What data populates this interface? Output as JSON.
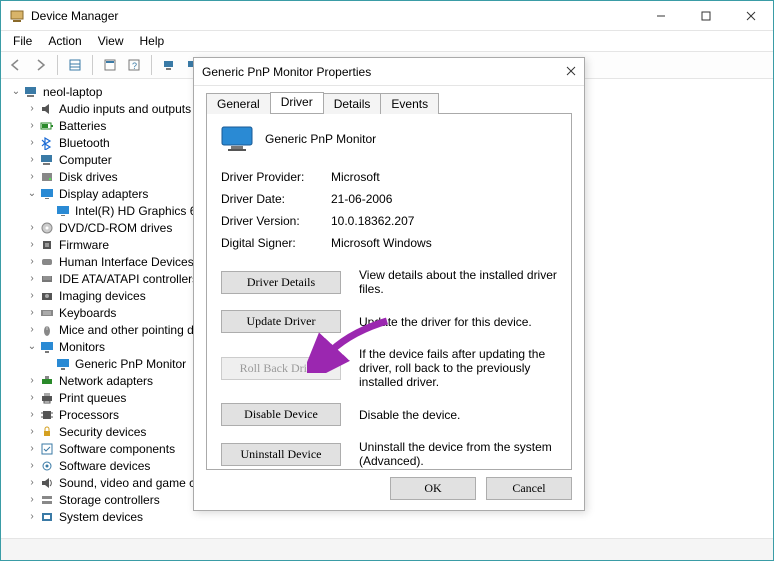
{
  "title": "Device Manager",
  "menubar": [
    "File",
    "Action",
    "View",
    "Help"
  ],
  "tree_root": "neol-laptop",
  "nodes": [
    {
      "label": "Audio inputs and outputs",
      "exp": ">",
      "icon": "audio",
      "indent": 2
    },
    {
      "label": "Batteries",
      "exp": ">",
      "icon": "battery",
      "indent": 2
    },
    {
      "label": "Bluetooth",
      "exp": ">",
      "icon": "bluetooth",
      "indent": 2
    },
    {
      "label": "Computer",
      "exp": ">",
      "icon": "computer",
      "indent": 2
    },
    {
      "label": "Disk drives",
      "exp": ">",
      "icon": "disk",
      "indent": 2
    },
    {
      "label": "Display adapters",
      "exp": "v",
      "icon": "display",
      "indent": 2
    },
    {
      "label": "Intel(R) HD Graphics 620",
      "exp": "",
      "icon": "display",
      "indent": 3
    },
    {
      "label": "DVD/CD-ROM drives",
      "exp": ">",
      "icon": "dvd",
      "indent": 2
    },
    {
      "label": "Firmware",
      "exp": ">",
      "icon": "firmware",
      "indent": 2
    },
    {
      "label": "Human Interface Devices",
      "exp": ">",
      "icon": "hid",
      "indent": 2
    },
    {
      "label": "IDE ATA/ATAPI controllers",
      "exp": ">",
      "icon": "ide",
      "indent": 2
    },
    {
      "label": "Imaging devices",
      "exp": ">",
      "icon": "imaging",
      "indent": 2
    },
    {
      "label": "Keyboards",
      "exp": ">",
      "icon": "keyboard",
      "indent": 2
    },
    {
      "label": "Mice and other pointing devices",
      "exp": ">",
      "icon": "mouse",
      "indent": 2
    },
    {
      "label": "Monitors",
      "exp": "v",
      "icon": "monitor",
      "indent": 2
    },
    {
      "label": "Generic PnP Monitor",
      "exp": "",
      "icon": "monitor",
      "indent": 3
    },
    {
      "label": "Network adapters",
      "exp": ">",
      "icon": "network",
      "indent": 2
    },
    {
      "label": "Print queues",
      "exp": ">",
      "icon": "printer",
      "indent": 2
    },
    {
      "label": "Processors",
      "exp": ">",
      "icon": "cpu",
      "indent": 2
    },
    {
      "label": "Security devices",
      "exp": ">",
      "icon": "security",
      "indent": 2
    },
    {
      "label": "Software components",
      "exp": ">",
      "icon": "swcomp",
      "indent": 2
    },
    {
      "label": "Software devices",
      "exp": ">",
      "icon": "swdev",
      "indent": 2
    },
    {
      "label": "Sound, video and game controllers",
      "exp": ">",
      "icon": "sound",
      "indent": 2
    },
    {
      "label": "Storage controllers",
      "exp": ">",
      "icon": "storage",
      "indent": 2
    },
    {
      "label": "System devices",
      "exp": ">",
      "icon": "system",
      "indent": 2
    }
  ],
  "dialog": {
    "title": "Generic PnP Monitor Properties",
    "tabs": [
      "General",
      "Driver",
      "Details",
      "Events"
    ],
    "active_tab": 1,
    "device_name": "Generic PnP Monitor",
    "info": [
      {
        "k": "Driver Provider:",
        "v": "Microsoft"
      },
      {
        "k": "Driver Date:",
        "v": "21-06-2006"
      },
      {
        "k": "Driver Version:",
        "v": "10.0.18362.207"
      },
      {
        "k": "Digital Signer:",
        "v": "Microsoft Windows"
      }
    ],
    "actions": [
      {
        "label": "Driver Details",
        "desc": "View details about the installed driver files.",
        "disabled": false
      },
      {
        "label": "Update Driver",
        "desc": "Update the driver for this device.",
        "disabled": false
      },
      {
        "label": "Roll Back Driver",
        "desc": "If the device fails after updating the driver, roll back to the previously installed driver.",
        "disabled": true
      },
      {
        "label": "Disable Device",
        "desc": "Disable the device.",
        "disabled": false
      },
      {
        "label": "Uninstall Device",
        "desc": "Uninstall the device from the system (Advanced).",
        "disabled": false
      }
    ],
    "ok": "OK",
    "cancel": "Cancel"
  }
}
